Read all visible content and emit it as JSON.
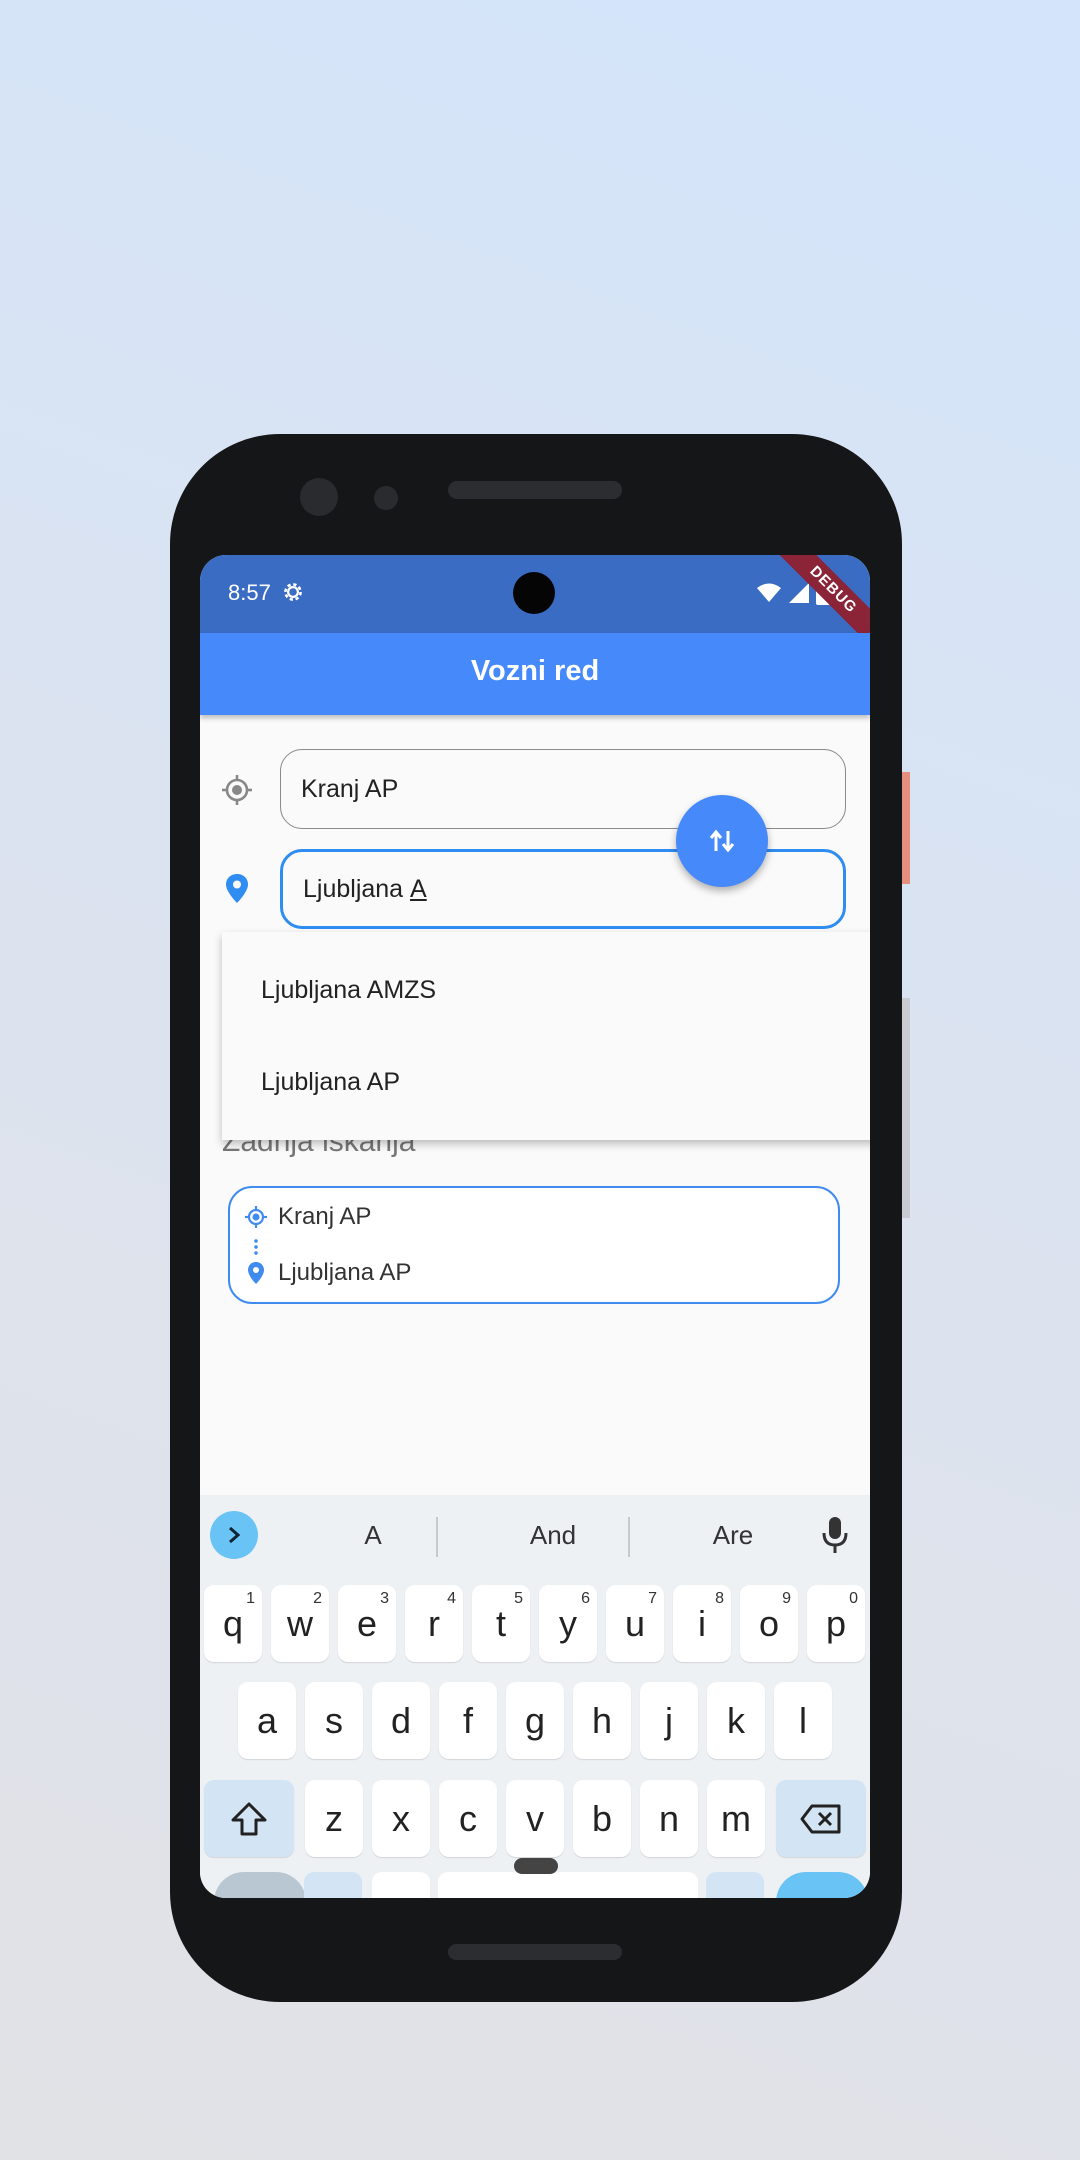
{
  "status_bar": {
    "time": "8:57",
    "debug_label": "DEBUG"
  },
  "app_bar": {
    "title": "Vozni red"
  },
  "from_field": {
    "value": "Kranj AP"
  },
  "to_field": {
    "typed": "Ljubljana ",
    "composing": "A"
  },
  "suggestions": [
    "Ljubljana AMZS",
    "Ljubljana AP"
  ],
  "recent": {
    "title": "Zadnja iskanja",
    "items": [
      {
        "from": "Kranj AP",
        "to": "Ljubljana AP"
      }
    ]
  },
  "keyboard": {
    "suggestions": [
      "A",
      "And",
      "Are"
    ],
    "row1": [
      {
        "key": "q",
        "num": "1"
      },
      {
        "key": "w",
        "num": "2"
      },
      {
        "key": "e",
        "num": "3"
      },
      {
        "key": "r",
        "num": "4"
      },
      {
        "key": "t",
        "num": "5"
      },
      {
        "key": "y",
        "num": "6"
      },
      {
        "key": "u",
        "num": "7"
      },
      {
        "key": "i",
        "num": "8"
      },
      {
        "key": "o",
        "num": "9"
      },
      {
        "key": "p",
        "num": "0"
      }
    ],
    "row2": [
      "a",
      "s",
      "d",
      "f",
      "g",
      "h",
      "j",
      "k",
      "l"
    ],
    "row3": [
      "z",
      "x",
      "c",
      "v",
      "b",
      "n",
      "m"
    ]
  },
  "colors": {
    "status_bar": "#3b6cc4",
    "app_bar": "#4689fa",
    "accent": "#2f8cf0",
    "debug_banner": "#8a2436"
  }
}
